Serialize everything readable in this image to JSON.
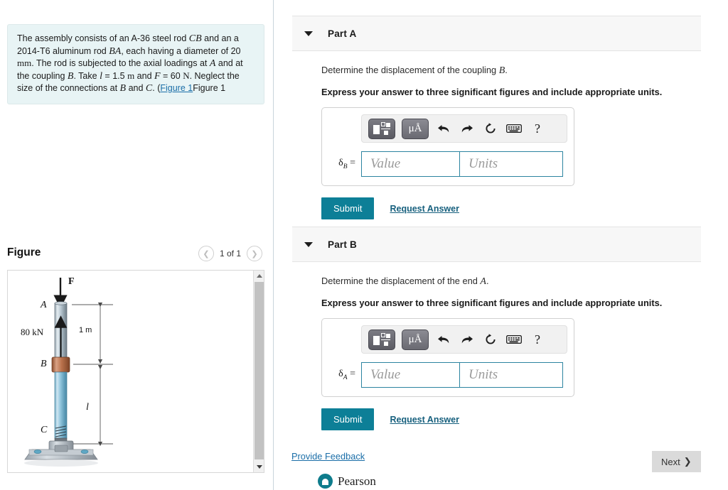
{
  "problem": {
    "text_segments": [
      "The assembly consists of an A-36 steel rod ",
      "CB",
      " and an a 2014-T6 aluminum rod ",
      "BA",
      ", each having a diameter of 20 ",
      "mm",
      ". The rod is subjected to the axial loadings at ",
      "A",
      " and at the coupling ",
      "B",
      ". Take ",
      "l",
      " = 1.5 ",
      "m",
      " and ",
      "F",
      " = 60 ",
      "N",
      ". Neglect the size of the connections at ",
      "B",
      " and ",
      "C",
      ". (",
      "Figure 1",
      ")"
    ],
    "figure_link": "Figure 1"
  },
  "figure": {
    "title": "Figure",
    "pager_label": "1 of 1",
    "prev_icon": "chevron-left-icon",
    "next_icon": "chevron-right-icon",
    "labels": {
      "force": "F",
      "point_a": "A",
      "point_b": "B",
      "point_c": "C",
      "load": "80 kN",
      "dim_top": "1 m",
      "dim_bottom": "l"
    }
  },
  "parts": [
    {
      "id": "part-a",
      "label": "Part A",
      "prompt_prefix": "Determine the displacement of the coupling ",
      "prompt_var": "B",
      "prompt_suffix": ".",
      "instruction": "Express your answer to three significant figures and include appropriate units.",
      "var_symbol": "δ",
      "var_subscript": "B",
      "equals": "=",
      "value_placeholder": "Value",
      "units_placeholder": "Units",
      "value": "",
      "units": "",
      "submit_label": "Submit",
      "request_label": "Request Answer",
      "toolbar": {
        "template_icon": "math-template-icon",
        "units_icon": "μÅ",
        "undo_icon": "undo-icon",
        "redo_icon": "redo-icon",
        "reset_icon": "reset-icon",
        "keyboard_icon": "keyboard-icon",
        "help_icon": "?"
      }
    },
    {
      "id": "part-b",
      "label": "Part B",
      "prompt_prefix": "Determine the displacement of the end ",
      "prompt_var": "A",
      "prompt_suffix": ".",
      "instruction": "Express your answer to three significant figures and include appropriate units.",
      "var_symbol": "δ",
      "var_subscript": "A",
      "equals": "=",
      "value_placeholder": "Value",
      "units_placeholder": "Units",
      "value": "",
      "units": "",
      "submit_label": "Submit",
      "request_label": "Request Answer",
      "toolbar": {
        "template_icon": "math-template-icon",
        "units_icon": "μÅ",
        "undo_icon": "undo-icon",
        "redo_icon": "redo-icon",
        "reset_icon": "reset-icon",
        "keyboard_icon": "keyboard-icon",
        "help_icon": "?"
      }
    }
  ],
  "footer": {
    "feedback_label": "Provide Feedback",
    "next_label": "Next",
    "next_icon": "chevron-right-icon",
    "brand_name": "Pearson",
    "brand_color": "#0e7c8c"
  },
  "colors": {
    "accent": "#0d7f97",
    "link": "#1a6ea8",
    "problem_bg": "#e8f4f5",
    "field_border": "#2c84a0"
  }
}
